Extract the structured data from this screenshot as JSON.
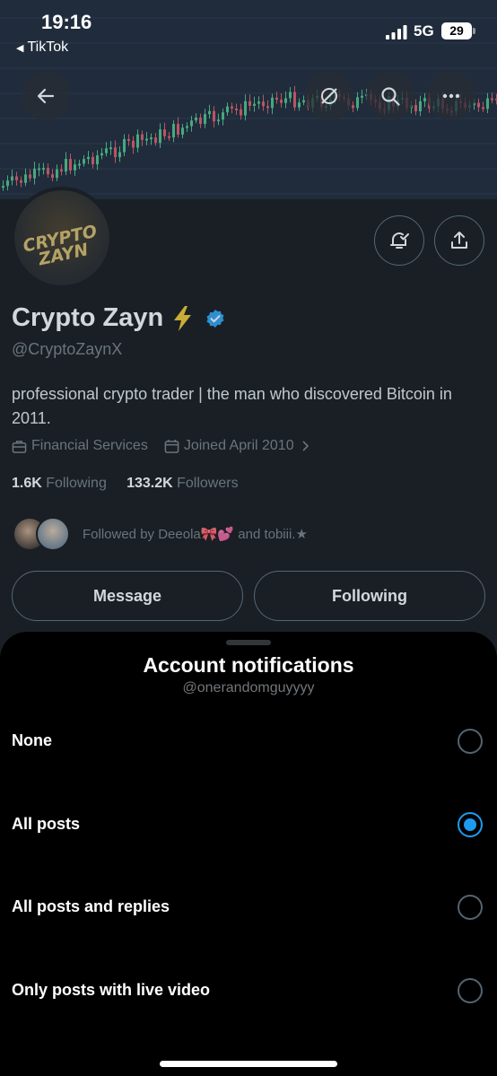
{
  "status_bar": {
    "time": "19:16",
    "back_app": "TikTok",
    "network": "5G",
    "battery": "29"
  },
  "header": {
    "back_icon": "arrow-left-icon",
    "grok_icon": "slashed-circle-icon",
    "search_icon": "search-icon",
    "more_icon": "more-horizontal-icon"
  },
  "profile": {
    "avatar_text_1": "CRYPTO",
    "avatar_text_2": "ZAYN",
    "name": "Crypto Zayn",
    "handle": "@CryptoZaynX",
    "bio": "professional crypto trader | the man who discovered Bitcoin in 2011.",
    "category": "Financial Services",
    "joined": "Joined April 2010",
    "following_count": "1.6K",
    "following_label": "Following",
    "followers_count": "133.2K",
    "followers_label": "Followers",
    "followed_by": "Followed by Deeola🎀💕 and tobiii.★",
    "message_button": "Message",
    "following_button": "Following"
  },
  "sheet": {
    "title": "Account notifications",
    "subtitle": "@onerandomguyyyy",
    "options": [
      {
        "label": "None",
        "selected": false
      },
      {
        "label": "All posts",
        "selected": true
      },
      {
        "label": "All posts and replies",
        "selected": false
      },
      {
        "label": "Only posts with live video",
        "selected": false
      }
    ]
  },
  "colors": {
    "accent": "#1d9bf0",
    "background": "#000000",
    "secondary_text": "#71767b",
    "border": "#536471",
    "bolt": "#f5c518"
  }
}
